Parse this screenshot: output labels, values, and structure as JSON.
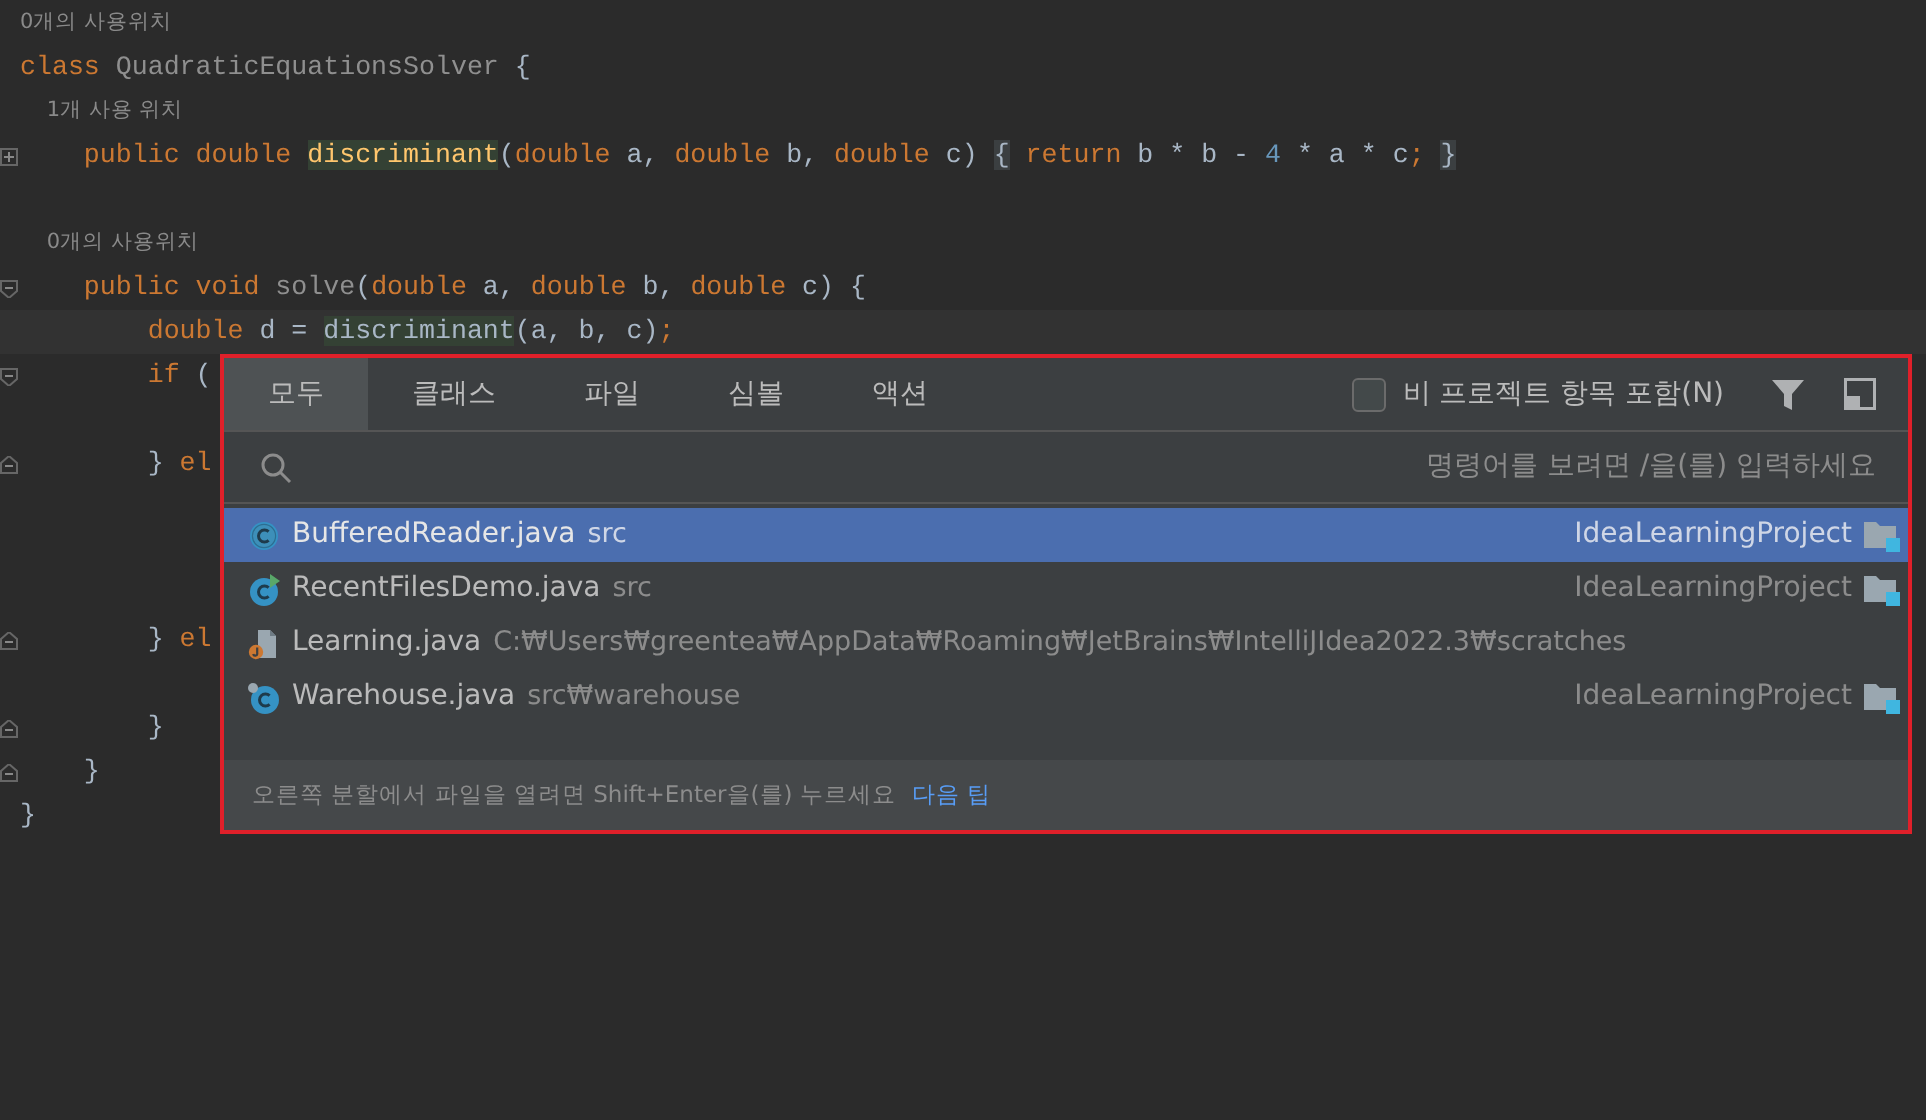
{
  "editor": {
    "lines": [
      {
        "kind": "hint",
        "text": "0개의 사용위치"
      },
      {
        "kind": "code",
        "tokens": [
          {
            "t": "class ",
            "kind": "kw"
          },
          {
            "t": "QuadraticEquationsSolver",
            "kind": "unused"
          },
          {
            "t": " {",
            "kind": "plain"
          }
        ]
      },
      {
        "kind": "hint",
        "text": "    1개 사용 위치"
      },
      {
        "kind": "code",
        "fold": {
          "kind": "collapsed"
        },
        "tokens": [
          {
            "t": "    public double ",
            "kind": "kw"
          },
          {
            "t": "discriminant",
            "kind": "decl",
            "highlighted": true
          },
          {
            "t": "(",
            "kind": "plain"
          },
          {
            "t": "double ",
            "kind": "kw"
          },
          {
            "t": "a, ",
            "kind": "plain"
          },
          {
            "t": "double ",
            "kind": "kw"
          },
          {
            "t": "b, ",
            "kind": "plain"
          },
          {
            "t": "double ",
            "kind": "kw"
          },
          {
            "t": "c) ",
            "kind": "plain"
          },
          {
            "t": "{",
            "kind": "plain",
            "highlighted": true
          },
          {
            "t": " return ",
            "kind": "kw"
          },
          {
            "t": "b * b - ",
            "kind": "plain"
          },
          {
            "t": "4",
            "kind": "num"
          },
          {
            "t": " * a * c",
            "kind": "plain"
          },
          {
            "t": "; ",
            "kind": "kw"
          },
          {
            "t": "}",
            "kind": "plain",
            "highlighted": true
          }
        ]
      },
      {
        "kind": "blank"
      },
      {
        "kind": "hint",
        "text": "    0개의 사용위치"
      },
      {
        "kind": "code",
        "fold": {
          "kind": "start"
        },
        "tokens": [
          {
            "t": "    public void ",
            "kind": "kw"
          },
          {
            "t": "solve",
            "kind": "unused"
          },
          {
            "t": "(",
            "kind": "plain"
          },
          {
            "t": "double ",
            "kind": "kw"
          },
          {
            "t": "a, ",
            "kind": "plain"
          },
          {
            "t": "double ",
            "kind": "kw"
          },
          {
            "t": "b, ",
            "kind": "plain"
          },
          {
            "t": "double ",
            "kind": "kw"
          },
          {
            "t": "c) {",
            "kind": "plain"
          }
        ]
      },
      {
        "kind": "code",
        "current": true,
        "tokens": [
          {
            "t": "        double ",
            "kind": "kw"
          },
          {
            "t": "d = ",
            "kind": "plain"
          },
          {
            "t": "discriminant",
            "kind": "plain",
            "highlighted": true
          },
          {
            "t": "(a, b, c)",
            "kind": "plain"
          },
          {
            "t": ";",
            "kind": "kw"
          }
        ]
      },
      {
        "kind": "code",
        "fold": {
          "kind": "start"
        },
        "tokens": [
          {
            "t": "        if ",
            "kind": "kw"
          },
          {
            "t": "(",
            "kind": "plain"
          }
        ]
      },
      {
        "kind": "blank"
      },
      {
        "kind": "code",
        "fold": {
          "kind": "end"
        },
        "tokens": [
          {
            "t": "        } ",
            "kind": "plain"
          },
          {
            "t": "el",
            "kind": "kw"
          }
        ]
      },
      {
        "kind": "blank"
      },
      {
        "kind": "blank"
      },
      {
        "kind": "blank"
      },
      {
        "kind": "code",
        "fold": {
          "kind": "end"
        },
        "tokens": [
          {
            "t": "        } ",
            "kind": "plain"
          },
          {
            "t": "el",
            "kind": "kw"
          }
        ]
      },
      {
        "kind": "blank"
      },
      {
        "kind": "code",
        "fold": {
          "kind": "end"
        },
        "tokens": [
          {
            "t": "        }",
            "kind": "plain"
          }
        ]
      },
      {
        "kind": "code",
        "fold": {
          "kind": "end"
        },
        "tokens": [
          {
            "t": "    }",
            "kind": "plain"
          }
        ]
      },
      {
        "kind": "code",
        "tokens": [
          {
            "t": "}",
            "kind": "plain"
          }
        ]
      }
    ]
  },
  "search_popup": {
    "tabs": [
      {
        "label": "모두",
        "selected": true
      },
      {
        "label": "클래스",
        "selected": false
      },
      {
        "label": "파일",
        "selected": false
      },
      {
        "label": "심볼",
        "selected": false
      },
      {
        "label": "액션",
        "selected": false
      }
    ],
    "include_non_project": {
      "label": "비 프로젝트 항목 포함(N)",
      "checked": false
    },
    "search": {
      "placeholder": "명령어를 보려면 /을(를) 입력하세요"
    },
    "results": [
      {
        "kind": "class",
        "name": "BufferedReader.java",
        "path": "src",
        "project": "IdeaLearningProject",
        "selected": true
      },
      {
        "kind": "runnable-class",
        "name": "RecentFilesDemo.java",
        "path": "src",
        "project": "IdeaLearningProject",
        "selected": false
      },
      {
        "kind": "scratch",
        "name": "Learning.java",
        "path": "C:₩Users₩greentea₩AppData₩Roaming₩JetBrains₩IntelliJIdea2022.3₩scratches",
        "selected": false
      },
      {
        "kind": "class-other",
        "name": "Warehouse.java",
        "path": "src₩warehouse",
        "project": "IdeaLearningProject",
        "selected": false
      }
    ],
    "footer": {
      "tip": "오른쪽 분할에서 파일을 열려면 Shift+Enter을(를) 누르세요",
      "link": "다음 팁"
    }
  }
}
